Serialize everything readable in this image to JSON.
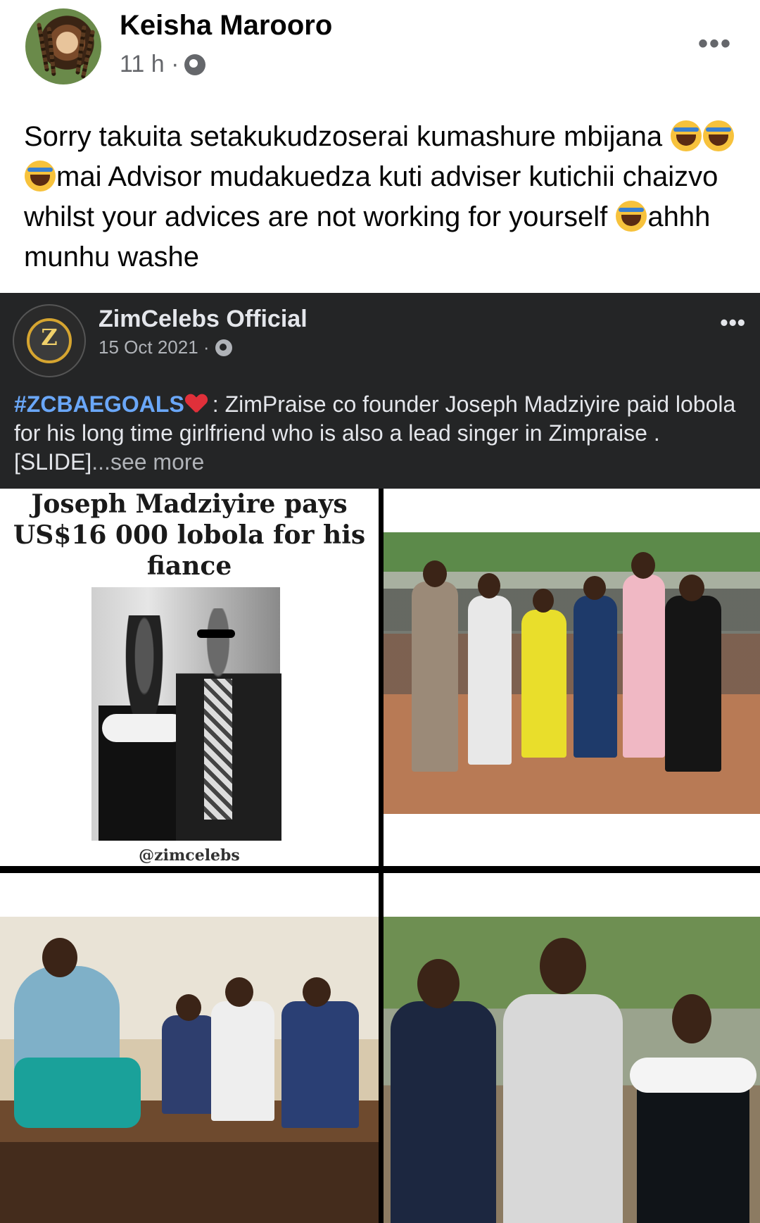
{
  "post": {
    "author": "Keisha Marooro",
    "time": "11 h ·",
    "text_part1": "Sorry takuita setakukudzoserai kumashure mbijana ",
    "text_part2": "mai Advisor mudakuedza kuti adviser kutichii chaizvo whilst your advices are not working for yourself ",
    "text_part3": "ahhh munhu washe",
    "more_icon": "•••"
  },
  "shared": {
    "page_name": "ZimCelebs Official",
    "date": "15 Oct 2021 ·",
    "avatar_letter": "Z",
    "hashtag": "#ZCBAEGOALS",
    "text": ": ZimPraise co founder Joseph Madziyire paid lobola for his long time girlfriend who is also a lead singer in Zimpraise . [SLIDE]",
    "see_more": "...see more",
    "more_icon": "•••"
  },
  "tiles": {
    "headline": "Joseph Madziyire pays US$16 000 lobola for his fiance",
    "watermark": "@zimcelebs"
  },
  "colors": {
    "dark_card": "#242526",
    "hashtag": "#6aa7f8",
    "meta_gray": "#65676b"
  }
}
